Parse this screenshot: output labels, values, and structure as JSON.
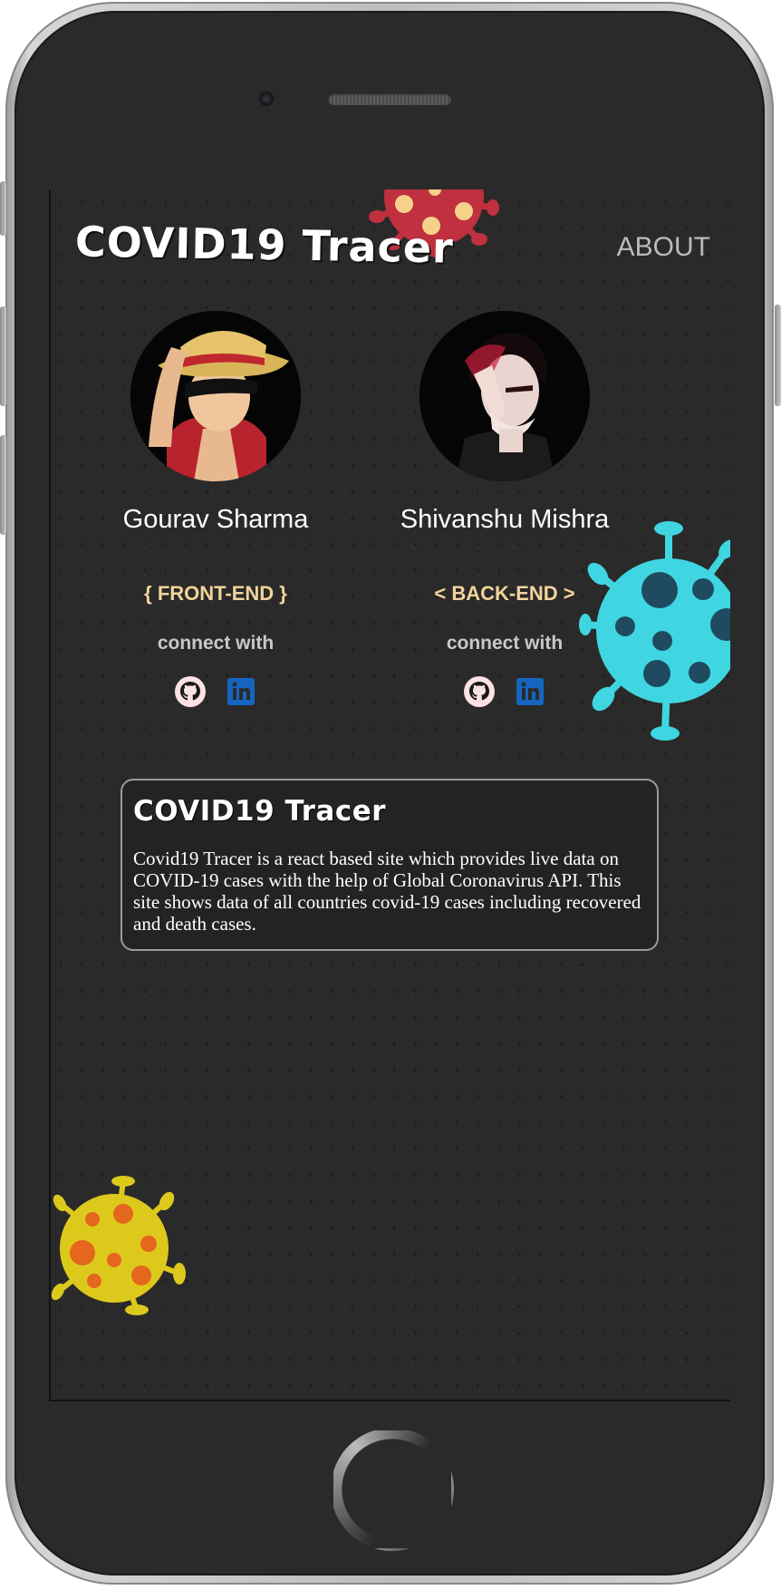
{
  "header": {
    "logo": "COVID19 Tracer",
    "nav_about": "ABOUT"
  },
  "members": [
    {
      "name": "Gourav Sharma",
      "role": "{ FRONT-END }",
      "connect_label": "connect with",
      "socials": [
        "github-icon",
        "linkedin-icon"
      ]
    },
    {
      "name": "Shivanshu Mishra",
      "role": "< BACK-END >",
      "connect_label": "connect with",
      "socials": [
        "github-icon",
        "linkedin-icon"
      ]
    }
  ],
  "about_card": {
    "title": "COVID19 Tracer",
    "text": "Covid19 Tracer is a react based site which provides live data on COVID-19 cases with the help of Global Coronavirus API. This site shows data of all countries covid-19 cases including recovered and death cases."
  },
  "colors": {
    "screen_bg": "#2a2a2a",
    "role_text": "#f2d49b",
    "virus_red": "#c0303f",
    "virus_cyan": "#3fd6e2",
    "virus_yellow": "#ddc91c",
    "linkedin": "#1565c0"
  }
}
